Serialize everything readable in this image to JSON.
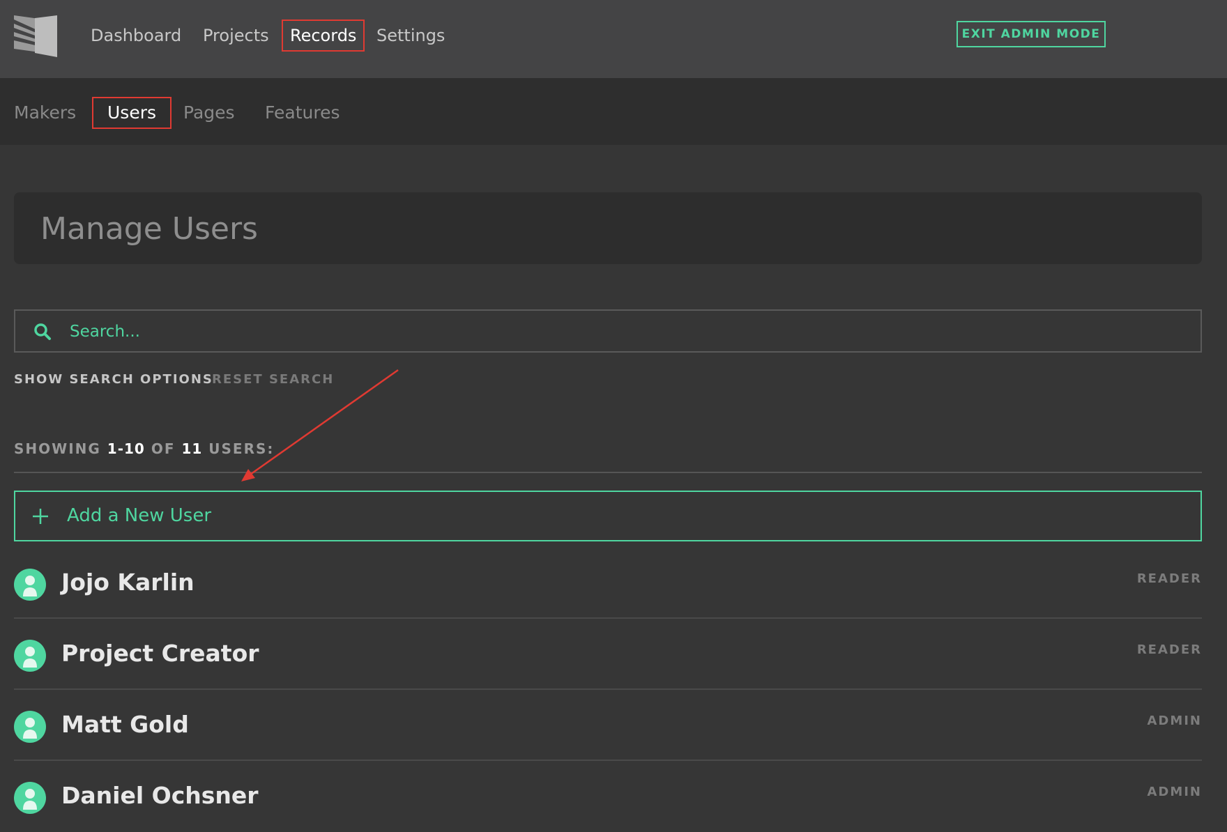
{
  "topnav": {
    "items": [
      {
        "label": "Dashboard",
        "active": false
      },
      {
        "label": "Projects",
        "active": false
      },
      {
        "label": "Records",
        "active": true
      },
      {
        "label": "Settings",
        "active": false
      }
    ],
    "exit_admin_label": "EXIT ADMIN MODE"
  },
  "subnav": {
    "items": [
      {
        "label": "Makers",
        "active": false
      },
      {
        "label": "Users",
        "active": true
      },
      {
        "label": "Pages",
        "active": false
      },
      {
        "label": "Features",
        "active": false
      }
    ]
  },
  "page": {
    "title": "Manage Users"
  },
  "search": {
    "placeholder": "Search...",
    "show_options_label": "SHOW SEARCH OPTIONS",
    "reset_label": "RESET SEARCH"
  },
  "results": {
    "prefix": "SHOWING",
    "range": "1-10",
    "of_label": "OF",
    "total": "11",
    "suffix": "USERS:"
  },
  "add_user": {
    "label": "Add a New User"
  },
  "users": [
    {
      "name": "Jojo Karlin",
      "role": "READER"
    },
    {
      "name": "Project Creator",
      "role": "READER"
    },
    {
      "name": "Matt Gold",
      "role": "ADMIN"
    },
    {
      "name": "Daniel Ochsner",
      "role": "ADMIN"
    }
  ],
  "colors": {
    "accent": "#4fd6a0",
    "annotation": "#e03a32",
    "topbar": "#444445",
    "subbar": "#2e2e2e",
    "background": "#363636"
  },
  "icons": [
    "logo-icon",
    "search-icon",
    "plus-icon",
    "user-avatar-icon"
  ]
}
